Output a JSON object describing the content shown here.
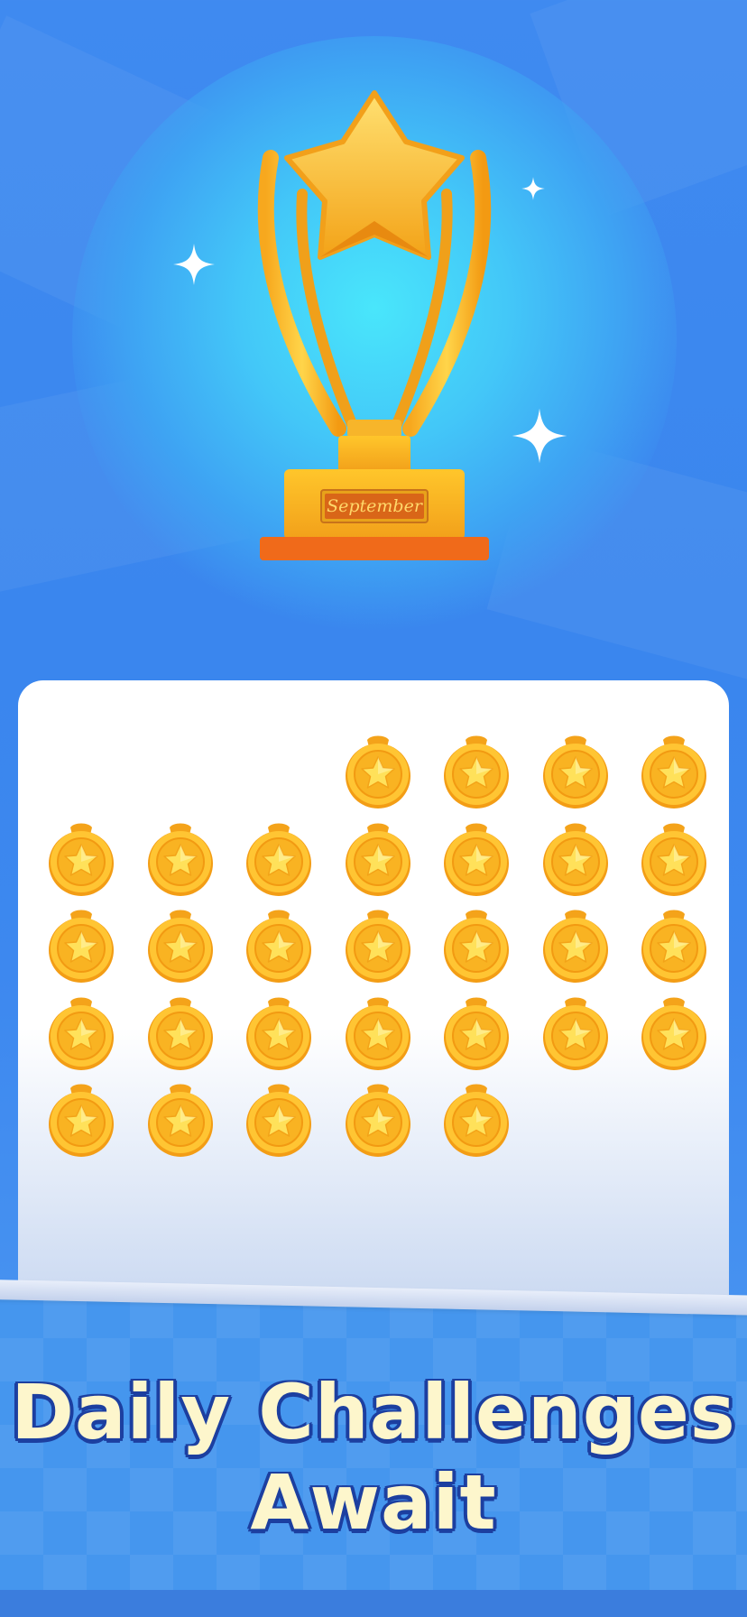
{
  "hero": {
    "trophy_plaque": "September",
    "icons": [
      "trophy-icon",
      "sparkle-icon"
    ]
  },
  "medals": {
    "row_1_count": 4,
    "row_2_count": 7,
    "row_3_count": 7,
    "row_4_count": 7,
    "row_5_count": 5,
    "total": 30,
    "icon": "star-medal-icon"
  },
  "headline": {
    "line1": "Daily Challenges",
    "line2": "Await"
  },
  "colors": {
    "background": "#3f8af0",
    "gold": "#f6b51c",
    "headline_text": "#fdf6cc",
    "headline_outline": "#1c3fa0"
  }
}
